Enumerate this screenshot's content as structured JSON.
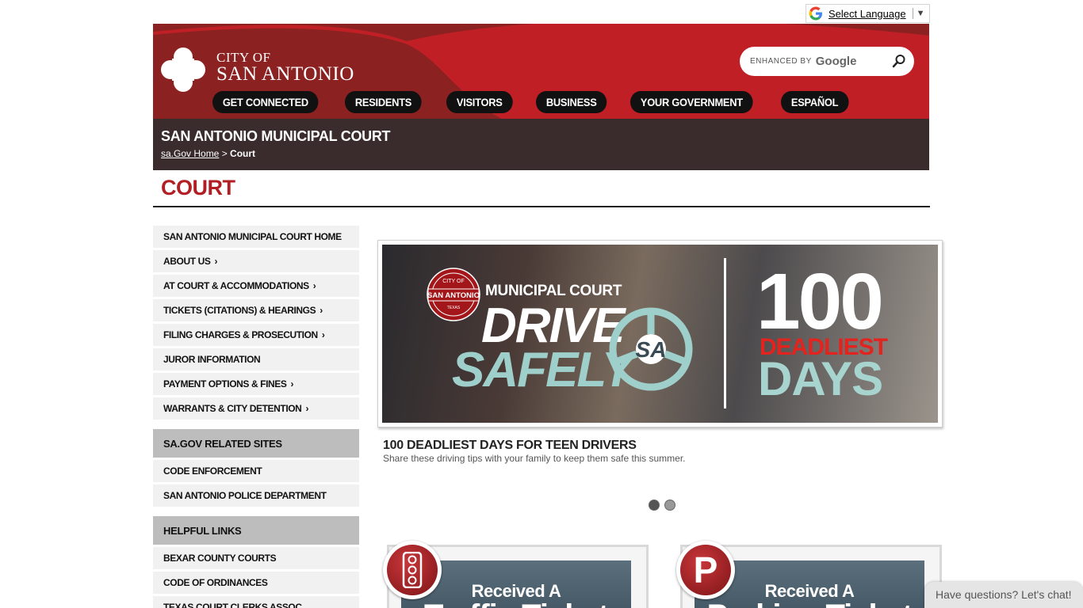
{
  "translate": {
    "label": "Select Language",
    "arrow": "▼"
  },
  "header": {
    "logo_line1": "CITY OF",
    "logo_line2": "SAN ANTONIO",
    "search": {
      "enhanced": "ENHANCED BY",
      "brand": "Google"
    },
    "nav": [
      "GET CONNECTED",
      "RESIDENTS",
      "VISITORS",
      "BUSINESS",
      "YOUR GOVERNMENT",
      "ESPAÑOL"
    ]
  },
  "band": {
    "title": "SAN ANTONIO MUNICIPAL COURT",
    "crumb_home": "sa.Gov Home",
    "crumb_sep": " > ",
    "crumb_current": "Court"
  },
  "page_heading": "COURT",
  "sidebar": {
    "items": [
      {
        "label": "SAN ANTONIO MUNICIPAL COURT HOME",
        "chevron": ""
      },
      {
        "label": "ABOUT US",
        "chevron": "›"
      },
      {
        "label": "AT COURT & ACCOMMODATIONS",
        "chevron": "›"
      },
      {
        "label": "TICKETS (CITATIONS) & HEARINGS",
        "chevron": "›"
      },
      {
        "label": "FILING CHARGES & PROSECUTION",
        "chevron": "›"
      },
      {
        "label": "JUROR INFORMATION",
        "chevron": ""
      },
      {
        "label": "PAYMENT OPTIONS & FINES",
        "chevron": "›"
      },
      {
        "label": "WARRANTS & CITY DETENTION",
        "chevron": "›"
      }
    ],
    "related_title": "SA.GOV RELATED SITES",
    "related": [
      "CODE ENFORCEMENT",
      "SAN ANTONIO POLICE DEPARTMENT"
    ],
    "helpful_title": "HELPFUL LINKS",
    "helpful": [
      "BEXAR COUNTY COURTS",
      "CODE OF ORDINANCES",
      "TEXAS COURT CLERKS ASSOC"
    ]
  },
  "slider": {
    "seal_top": "CITY OF",
    "seal_mid": "SAN ANTONIO",
    "seal_bot": "TEXAS",
    "municipal_court": "MUNICIPAL COURT",
    "drive": "DRIVE",
    "safely": "SAFELY",
    "wheel_text": "SA",
    "big_number": "100",
    "deadliest": "DEADLIEST",
    "days": "DAYS",
    "caption_title": "100 DEADLIEST DAYS FOR TEEN DRIVERS",
    "caption_sub": "Share these driving tips with your family to keep them safe this summer.",
    "active_dot": 0
  },
  "cards": [
    {
      "line1": "Received A",
      "line2": "Traffic Ticket",
      "badge": "traffic-light-icon"
    },
    {
      "line1": "Received A",
      "line2": "Parking Ticket",
      "badge_letter": "P"
    }
  ],
  "chat": {
    "label": "Have questions? Let's chat!"
  },
  "colors": {
    "brand_red": "#b11f24",
    "header_dark": "#8b2221",
    "band": "#3a2c2c"
  }
}
